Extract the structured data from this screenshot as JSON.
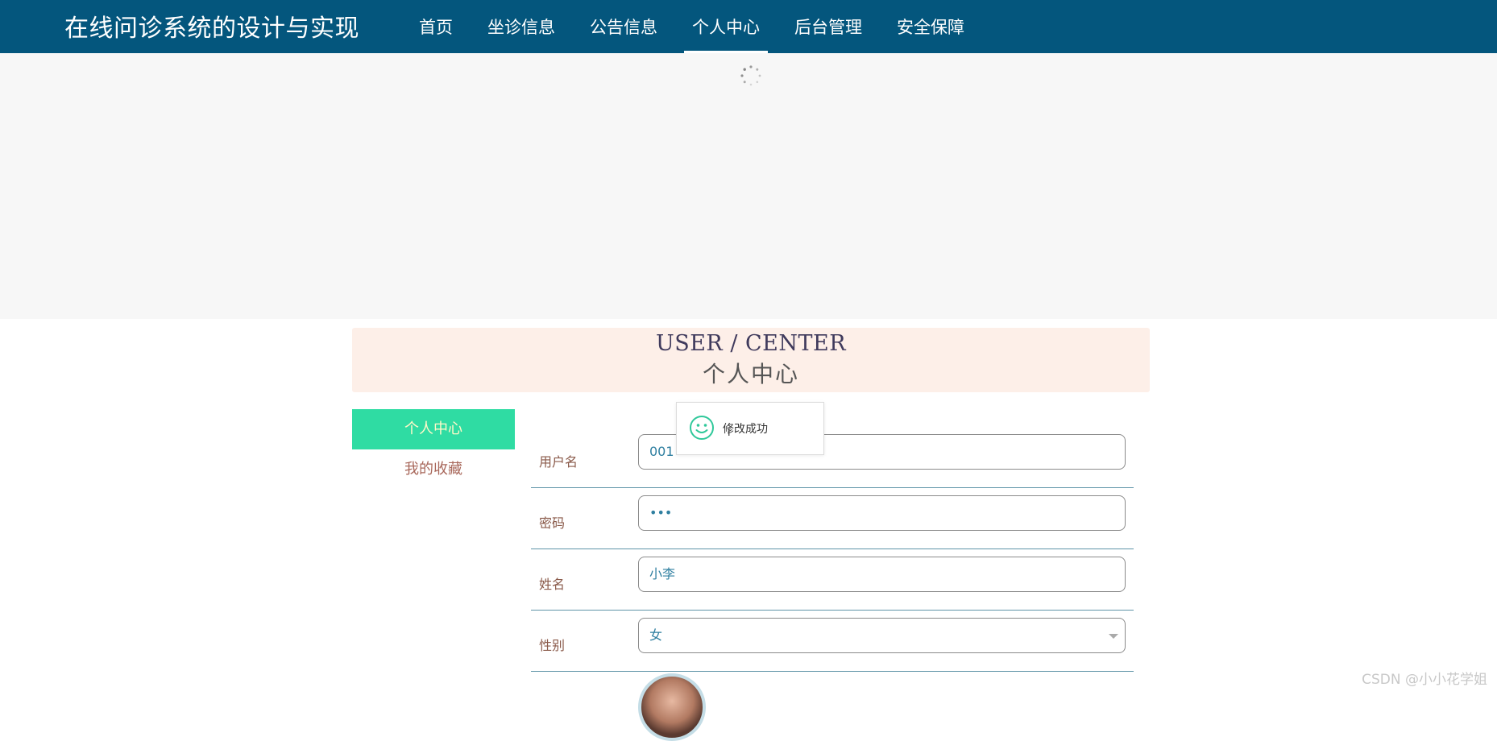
{
  "header": {
    "site_title": "在线问诊系统的设计与实现",
    "nav": [
      {
        "label": "首页",
        "active": false
      },
      {
        "label": "坐诊信息",
        "active": false
      },
      {
        "label": "公告信息",
        "active": false
      },
      {
        "label": "个人中心",
        "active": true
      },
      {
        "label": "后台管理",
        "active": false
      },
      {
        "label": "安全保障",
        "active": false
      }
    ],
    "bg_color": "#04567d"
  },
  "center_header": {
    "title_en": "USER / CENTER",
    "title_zh": "个人中心"
  },
  "side_menu": {
    "items": [
      {
        "label": "个人中心",
        "active": true
      },
      {
        "label": "我的收藏",
        "active": false
      }
    ],
    "active_color": "#2fdca3"
  },
  "form": {
    "fields": [
      {
        "label": "用户名",
        "value": "001"
      },
      {
        "label": "密码",
        "value": "•••"
      },
      {
        "label": "姓名",
        "value": "小李"
      },
      {
        "label": "性别",
        "value": "女"
      }
    ]
  },
  "toast": {
    "message": "修改成功",
    "icon": "smile-icon",
    "cursor": "I"
  },
  "watermark": "CSDN @小小花学姐"
}
